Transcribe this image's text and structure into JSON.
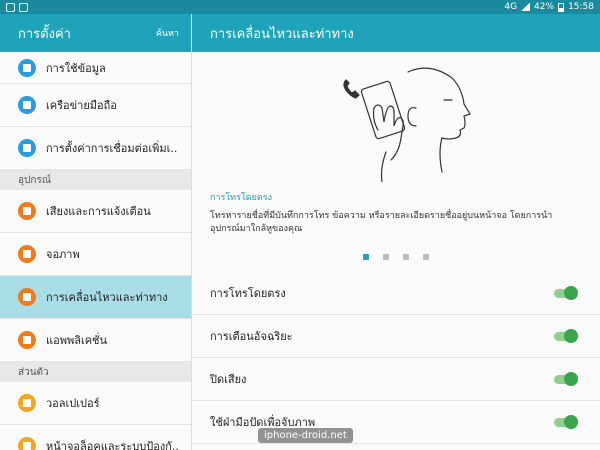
{
  "status_bar": {
    "network": "4G",
    "battery": "42%",
    "time": "15:58"
  },
  "sidebar": {
    "title": "การตั้งค่า",
    "search_label": "ค้นหา",
    "items": [
      {
        "label": "การใช้ข้อมูล",
        "icon": "data-usage-icon",
        "color": "#2b9be0"
      },
      {
        "label": "เครือข่ายมือถือ",
        "icon": "mobile-network-icon",
        "color": "#2b9be0"
      },
      {
        "label": "การตั้งค่าการเชื่อมต่อเพิ่มเ..",
        "icon": "more-connections-icon",
        "color": "#2b9be0"
      }
    ],
    "section_device": "อุปกรณ์",
    "device_items": [
      {
        "label": "เสียงและการแจ้งเตือน",
        "icon": "sound-icon",
        "color": "#f07b1d"
      },
      {
        "label": "จอภาพ",
        "icon": "display-icon",
        "color": "#f07b1d"
      },
      {
        "label": "การเคลื่อนไหวและท่าทาง",
        "icon": "motion-icon",
        "color": "#f07b1d"
      },
      {
        "label": "แอพพลิเคชั่น",
        "icon": "apps-icon",
        "color": "#f07b1d"
      }
    ],
    "section_personal": "ส่วนตัว",
    "personal_items": [
      {
        "label": "วอลเปเปอร์",
        "icon": "wallpaper-icon",
        "color": "#f5a623"
      },
      {
        "label": "หน้าจอล็อคและระบบป้องกั..",
        "icon": "lock-icon",
        "color": "#f5a623"
      }
    ]
  },
  "main": {
    "title": "การเคลื่อนไหวและท่าทาง",
    "feature_title": "การโทรโดยตรง",
    "feature_desc": "โทรหารายชื่อที่มีบันทึกการโทร ข้อความ หรือรายละเอียดรายชื่ออยู่บนหน้าจอ โดยการนำอุปกรณ์มาใกล้หูของคุณ",
    "toggles": [
      {
        "label": "การโทรโดยตรง",
        "on": true
      },
      {
        "label": "การเตือนอัจฉริยะ",
        "on": true
      },
      {
        "label": "ปิดเสียง",
        "on": true
      },
      {
        "label": "ใช้ฝ่ามือปัดเพื่อจับภาพ",
        "on": true
      }
    ]
  },
  "watermark": "iphone-droid.net"
}
